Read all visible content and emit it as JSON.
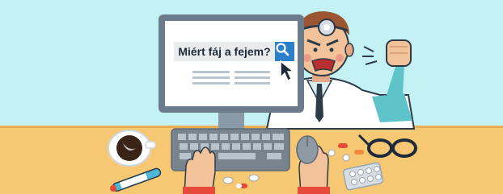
{
  "search": {
    "query": "Miért fáj a fejem?",
    "button_icon": "magnifier-icon"
  },
  "colors": {
    "sky": "#c4f1f3",
    "desk": "#f6c873",
    "monitor_frame": "#6b7d8c",
    "search_button": "#2c80c8",
    "keyboard": "#77848e",
    "doctor_coat": "#ffffff",
    "sleeve_teal": "#5ec4c9",
    "skin": "#f2c29b"
  },
  "icons": [
    "magnifier-icon",
    "cursor-arrow-icon",
    "head-mirror-icon",
    "coffee-cup-icon",
    "thermometer-icon",
    "glasses-icon",
    "pill-blister-icon",
    "pills-icon",
    "mouse-icon"
  ]
}
